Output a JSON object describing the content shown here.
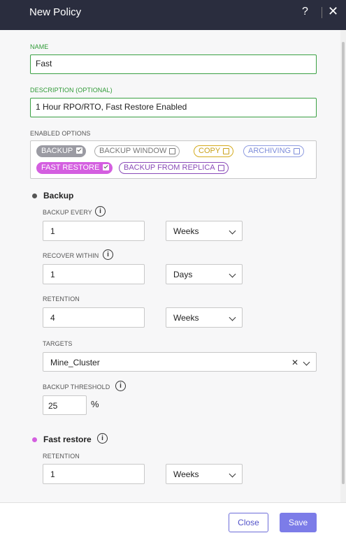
{
  "header": {
    "title": "New Policy",
    "help_label": "?",
    "close_label": "✕"
  },
  "name_field": {
    "label": "NAME",
    "value": "Fast"
  },
  "description_field": {
    "label": "DESCRIPTION (OPTIONAL)",
    "value": "1 Hour RPO/RTO, Fast Restore Enabled"
  },
  "enabled_options": {
    "label": "ENABLED OPTIONS",
    "chips": [
      {
        "label": "BACKUP",
        "checked": true,
        "color": "#9b9ba3"
      },
      {
        "label": "BACKUP WINDOW",
        "checked": false,
        "color": "#888888"
      },
      {
        "label": "COPY",
        "checked": false,
        "color": "#c9a11a"
      },
      {
        "label": "ARCHIVING",
        "checked": false,
        "color": "#7d8cd9"
      },
      {
        "label": "FAST RESTORE",
        "checked": true,
        "color": "#d45fe0"
      },
      {
        "label": "BACKUP FROM REPLICA",
        "checked": false,
        "color": "#8a4bb8"
      }
    ]
  },
  "backup": {
    "title": "Backup",
    "dot_color": "#555555",
    "backup_every": {
      "label": "BACKUP EVERY",
      "value": "1",
      "unit": "Weeks"
    },
    "recover_within": {
      "label": "RECOVER WITHIN",
      "value": "1",
      "unit": "Days"
    },
    "retention": {
      "label": "RETENTION",
      "value": "4",
      "unit": "Weeks"
    },
    "targets": {
      "label": "TARGETS",
      "value": "Mine_Cluster",
      "clear_label": "✕"
    },
    "backup_threshold": {
      "label": "BACKUP THRESHOLD",
      "value": "25",
      "unit": "%"
    }
  },
  "fast_restore": {
    "title": "Fast restore",
    "dot_color": "#d45fe0",
    "retention": {
      "label": "RETENTION",
      "value": "1",
      "unit": "Weeks"
    }
  },
  "footer": {
    "close_label": "Close",
    "save_label": "Save"
  },
  "icons": {
    "info": "i"
  }
}
